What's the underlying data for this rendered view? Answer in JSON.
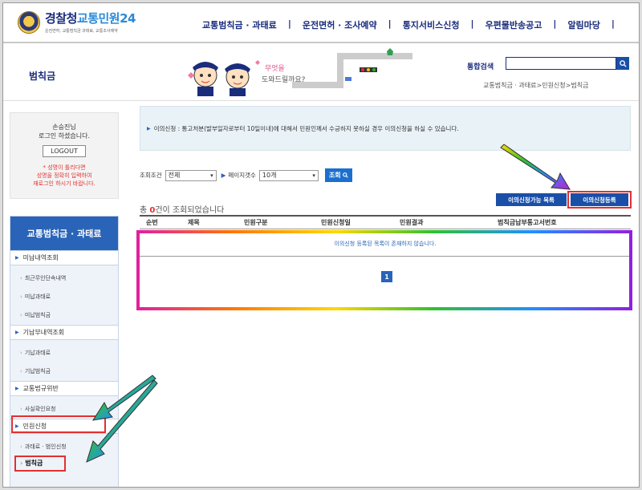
{
  "header": {
    "logo_title": "경찰청",
    "logo_sub": "교통민원24",
    "logo_tagline": "운전면허, 교통범칙금 과태료, 교통조사예약",
    "nav": [
      "교통범칙금 · 과태료",
      "운전면허 · 조사예약",
      "통지서비스신청",
      "우편물반송공고",
      "알림마당"
    ],
    "section_title": "범칙금",
    "mascot_speech": "무엇을 도와드릴까요?",
    "search_label": "통합검색",
    "search_value": "",
    "breadcrumb": "교통범칙금 · 과태료>민원신청>범칙금"
  },
  "login": {
    "greeting": "손승진님",
    "greeting2": "로그인 하셨습니다.",
    "logout_label": "LOGOUT",
    "warning_lines": [
      "* 성명이 틀리다면",
      "성명을 정확히 입력하여",
      "재로그인 하시기 바랍니다."
    ]
  },
  "sidebar": {
    "title": "교통범칙금 · 과태료",
    "items": [
      {
        "label": "미납내역조회",
        "level": "main"
      },
      {
        "label": "최근무인단속내역",
        "level": "sub"
      },
      {
        "label": "미납과태료",
        "level": "sub"
      },
      {
        "label": "미납범칙금",
        "level": "sub"
      },
      {
        "label": "기납부내역조회",
        "level": "main"
      },
      {
        "label": "기납과태료",
        "level": "sub"
      },
      {
        "label": "기납범칙금",
        "level": "sub"
      },
      {
        "label": "교통법규위반",
        "level": "main"
      },
      {
        "label": "사실확인요청",
        "level": "sub"
      },
      {
        "label": "민원신청",
        "level": "main"
      },
      {
        "label": "과태료 · 범인신청",
        "level": "sub"
      },
      {
        "label": "범칙금",
        "level": "sub"
      }
    ]
  },
  "main": {
    "info_text": "이의신청 : 통고처분(발부일자로부터 10일이내)에 대해서 민원인께서 수긍하지 못하실 경우 이의신청을 하실 수 있습니다.",
    "filter": {
      "condition_label": "조회조건",
      "condition_value": "전체",
      "pagesize_label": "페이지갯수",
      "pagesize_value": "10개",
      "lookup_label": "조회"
    },
    "count_prefix": "총",
    "count_value": "0",
    "count_suffix": "건이 조회되었습니다",
    "btn_list": "이의신청가능 목록",
    "btn_register": "이의신청등록",
    "table_headers": [
      "순번",
      "제목",
      "민원구분",
      "민원신청일",
      "민원결과",
      "범칙금납부통고서번호"
    ],
    "empty_message": "이의신청 등록된 목록이 존재하지 않습니다.",
    "page": "1"
  },
  "colors": {
    "brand": "#1a2c7c",
    "accent": "#2a64b8",
    "warning": "#e23030"
  }
}
